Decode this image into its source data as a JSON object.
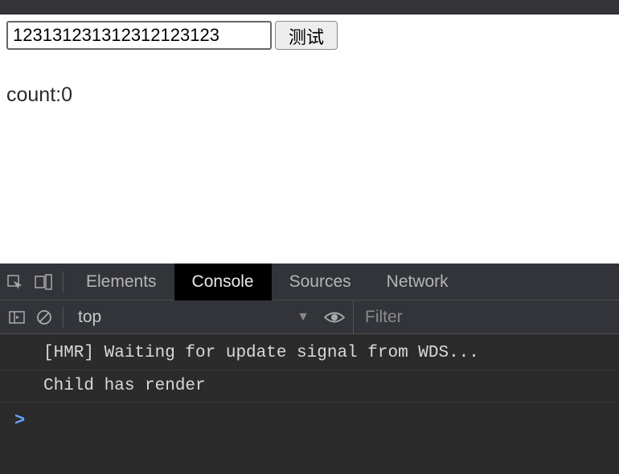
{
  "app": {
    "input_value": "123131231312312123123",
    "button_label": "测试",
    "count_label": "count:",
    "count_value": "0"
  },
  "devtools": {
    "tabs": {
      "elements": "Elements",
      "console": "Console",
      "sources": "Sources",
      "network": "Network"
    },
    "context": "top",
    "filter_placeholder": "Filter",
    "logs": [
      "[HMR] Waiting for update signal from WDS...",
      "Child has render"
    ],
    "prompt": ">"
  }
}
